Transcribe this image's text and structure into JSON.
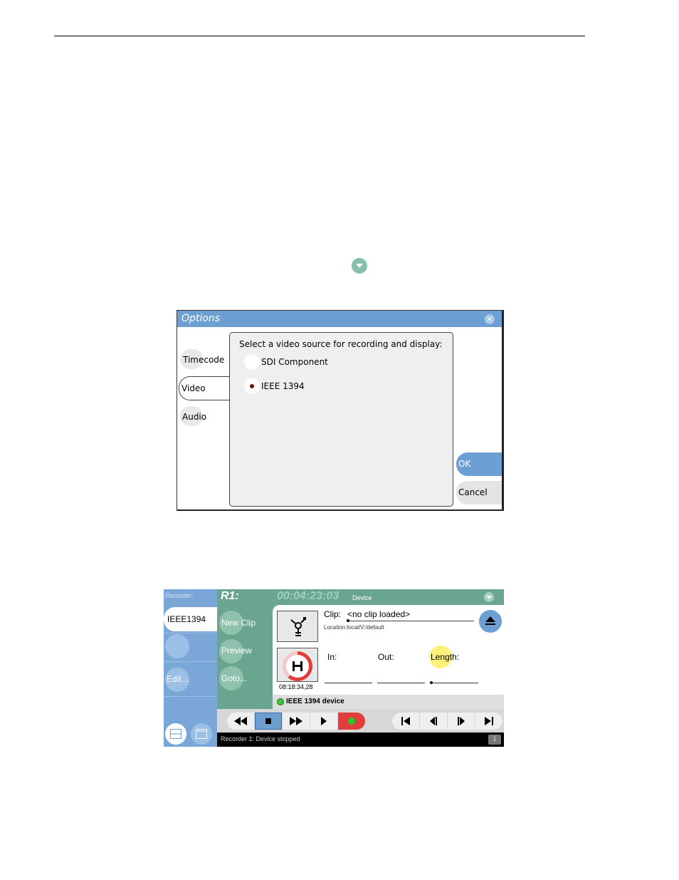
{
  "options_dialog": {
    "title": "Options",
    "close_glyph": "×",
    "tabs": [
      "Timecode",
      "Video",
      "Audio"
    ],
    "selected_tab": "Video",
    "prompt": "Select a video source for recording and display:",
    "sources": [
      "SDI Component",
      "IEEE 1394"
    ],
    "selected_source": "IEEE 1394",
    "ok_label": "OK",
    "cancel_label": "Cancel",
    "accent_color": "#6d9fd3"
  },
  "recorder": {
    "sidebar_title": "Recorder:",
    "channel_label": "IEEE1394",
    "edit_label": "Edit...",
    "channel_name": "R1:",
    "timecode": "00:04:23:03",
    "timecode_source": "Device",
    "actions": [
      "New Clip",
      "Preview",
      "Goto..."
    ],
    "clip_label": "Clip:",
    "clip_value": "<no clip loaded>",
    "location": "Location:local/V:/default",
    "disk_time": "08:18:34,28",
    "in_label": "In:",
    "out_label": "Out:",
    "length_label": "Length:",
    "device_status": "IEEE 1394 device",
    "status_message": "Recorder 1: Device stopped",
    "info_glyph": "i",
    "header_color": "#6aa68f",
    "sidebar_color": "#7aa6d8",
    "record_color": "#e23d3d"
  }
}
